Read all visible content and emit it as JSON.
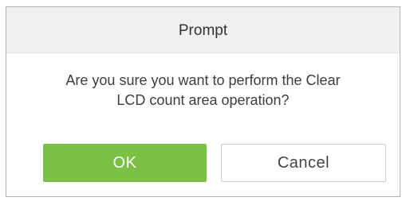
{
  "dialog": {
    "title": "Prompt",
    "message_line1": "Are you sure you want to perform the Clear",
    "message_line2": "LCD count area operation?",
    "ok_label": "OK",
    "cancel_label": "Cancel"
  },
  "colors": {
    "ok_button": "#7ac143",
    "header_bg": "#f0f0f0"
  }
}
